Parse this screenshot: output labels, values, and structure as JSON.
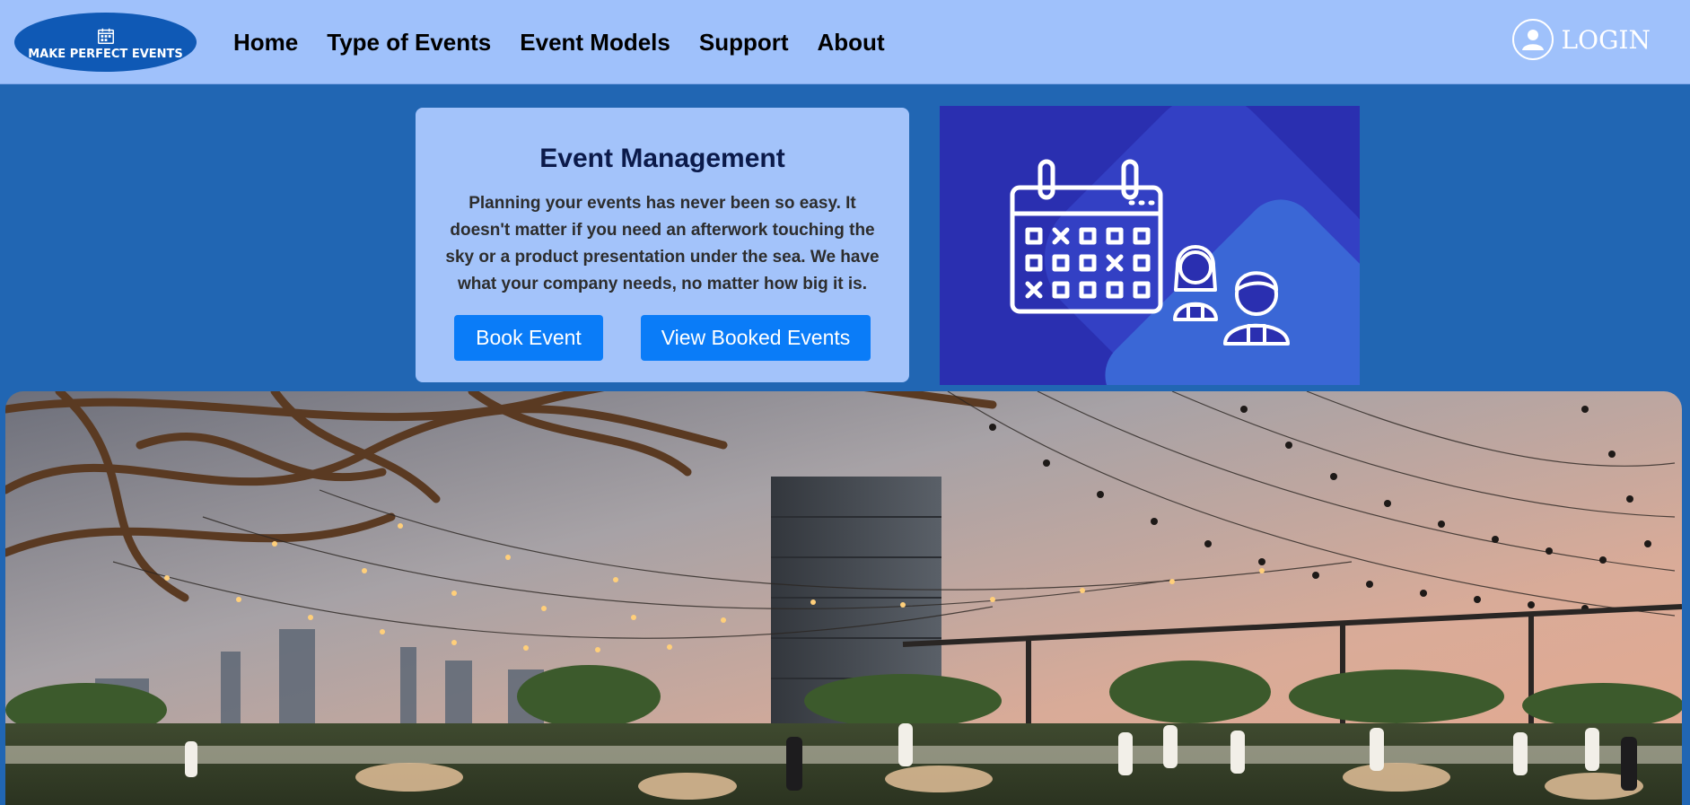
{
  "header": {
    "logo_text": "MAKE PERFECT EVENTS",
    "nav": [
      "Home",
      "Type of Events",
      "Event Models",
      "Support",
      "About"
    ],
    "login_label": "LOGIN"
  },
  "hero": {
    "title": "Event Management",
    "description": "Planning your events has never been so easy. It doesn't matter if you need an afterwork touching the sky or a product presentation under the sea. We have what your company needs, no matter how big it is.",
    "book_button": "Book Event",
    "view_button": "View Booked Events"
  },
  "colors": {
    "page_bg": "#2166b3",
    "header_bg": "#9fc1fb",
    "card_bg": "#a3c3fa",
    "button": "#0a7cf8",
    "logo_bg": "#0f59b5",
    "illustration_bg": "#2a2fb0"
  },
  "icons": {
    "logo": "calendar-icon",
    "login": "user-icon",
    "illustration": "calendar-with-attendees-illustration"
  }
}
